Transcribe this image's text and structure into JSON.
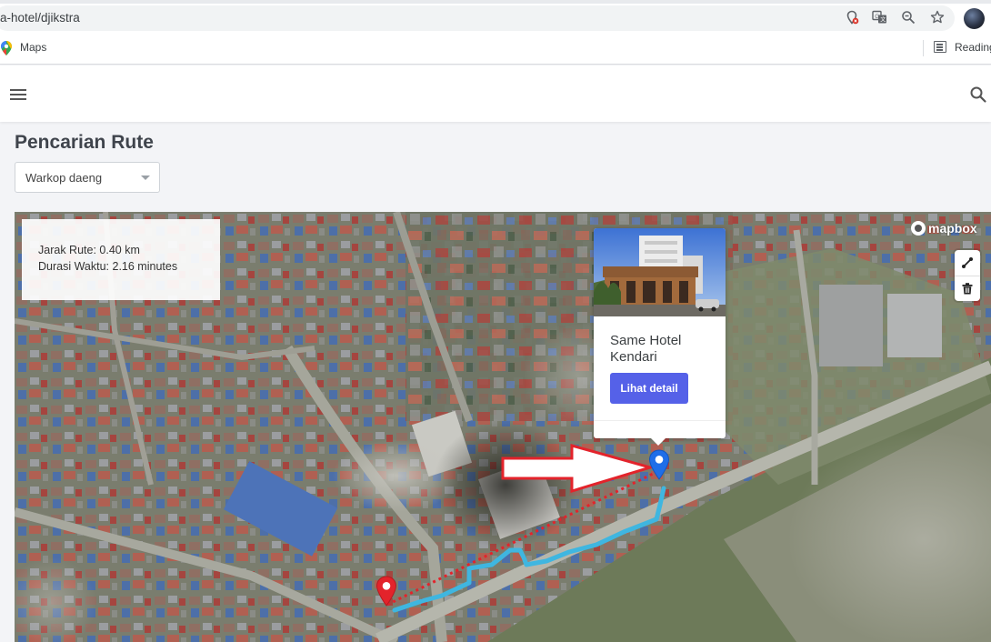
{
  "browser": {
    "url": "a-hotel/djikstra",
    "bookmarks": [
      {
        "label": "Maps"
      }
    ],
    "reading_list_label": "Reading"
  },
  "page": {
    "title": "Pencarian Rute",
    "select": {
      "value": "Warkop daeng"
    }
  },
  "map": {
    "route_info": {
      "distance_text": "Jarak Rute: 0.40 km",
      "duration_text": "Durasi Waktu: 2.16 minutes"
    },
    "attribution": "mapbox",
    "popup": {
      "hotel_name": "Same Hotel Kendari",
      "button_label": "Lihat detail"
    },
    "colors": {
      "route": "#3fb6e0",
      "dashed_line": "#e3232b",
      "origin_marker": "#e3232b",
      "destination_marker": "#1f6ee8",
      "annotation_arrow": "#e3232b",
      "button": "#5561e8"
    }
  }
}
